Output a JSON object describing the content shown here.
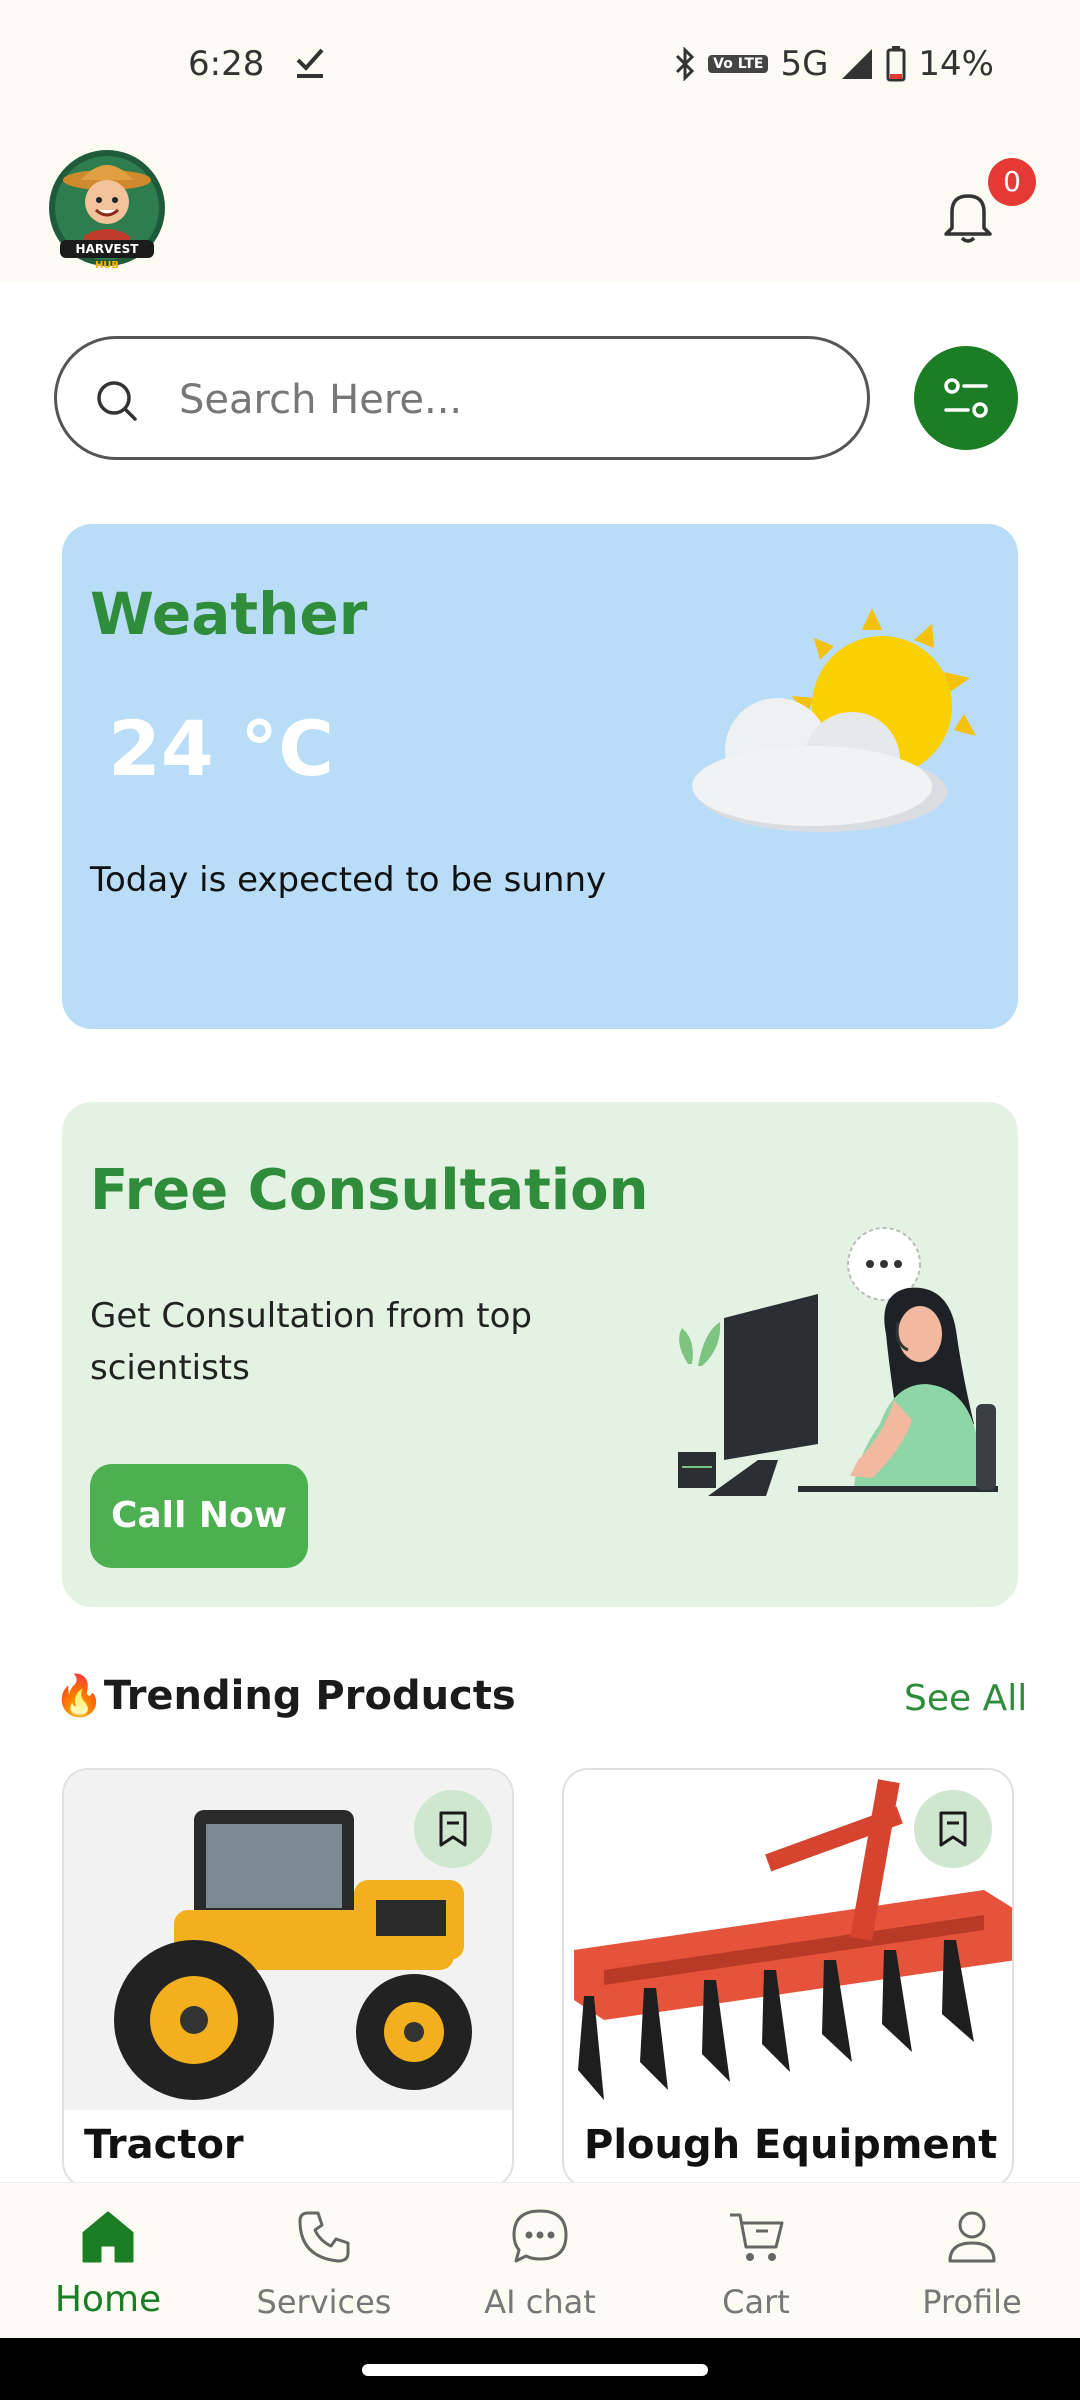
{
  "status_bar": {
    "time": "6:28",
    "network": "5G",
    "volte": "Vo LTE",
    "battery": "14%",
    "icons": [
      "download-done-icon",
      "bluetooth-icon",
      "volte-icon",
      "signal-icon",
      "battery-icon"
    ]
  },
  "header": {
    "logo_text": "HARVEST HUB",
    "notification_count": "0"
  },
  "search": {
    "placeholder": "Search Here..."
  },
  "weather": {
    "title": "Weather",
    "temperature": "24 °C",
    "description": "Today is expected to be sunny"
  },
  "consultation": {
    "title": "Free Consultation",
    "description": "Get Consultation from top scientists",
    "button_label": "Call Now"
  },
  "trending": {
    "icon": "🔥",
    "title": "Trending Products",
    "see_all": "See All",
    "products": [
      {
        "name": "Tractor"
      },
      {
        "name": "Plough Equipment"
      }
    ]
  },
  "bottom_nav": {
    "items": [
      {
        "label": "Home",
        "active": true
      },
      {
        "label": "Services",
        "active": false
      },
      {
        "label": "AI chat",
        "active": false
      },
      {
        "label": "Cart",
        "active": false
      },
      {
        "label": "Profile",
        "active": false
      }
    ]
  },
  "colors": {
    "primary_green": "#1b7d24",
    "title_green": "#2f8c3a",
    "button_green": "#4caf50",
    "weather_bg": "#b9dcf7",
    "consult_bg": "#e4f2e4",
    "header_bg": "#fbfbf3",
    "badge_red": "#e53935"
  }
}
